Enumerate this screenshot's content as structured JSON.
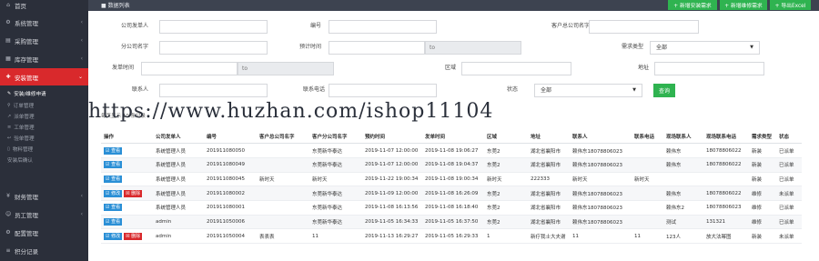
{
  "sidebar": {
    "items": [
      {
        "label": "首页",
        "icon": "home-icon",
        "top": 0
      },
      {
        "label": "系统管理",
        "icon": "gear-icon"
      },
      {
        "label": "采购管理",
        "icon": "cart-icon"
      },
      {
        "label": "库存管理",
        "icon": "box-icon"
      },
      {
        "label": "安装管理",
        "icon": "wrench-icon"
      }
    ],
    "submenu": [
      "安装/维修申请",
      "订单管理",
      "派单管理",
      "工单管理",
      "验单管理",
      "物料管理",
      "安装后确认"
    ],
    "items_after": [
      {
        "label": "财务管理",
        "icon": "money-icon"
      },
      {
        "label": "员工管理",
        "icon": "user-icon"
      },
      {
        "label": "配置管理",
        "icon": "settings-icon"
      },
      {
        "label": "积分记录",
        "icon": "list-icon"
      }
    ]
  },
  "header": {
    "title": "数据列表",
    "buttons": [
      "+ 新增安装需求",
      "+ 新增维修需求",
      "+ 导出Excel"
    ]
  },
  "filters": {
    "requester_label": "公司发单人",
    "number_label": "编号",
    "client_company_label": "客户总公司名字",
    "branch_label": "分公司名字",
    "appointment_label": "预计时间",
    "range_to": "to",
    "demand_type_label": "需求类型",
    "demand_type_value": "全部",
    "order_time_label": "发单时间",
    "area_label": "区域",
    "address_label": "地址",
    "contact_label": "联系人",
    "phone_label": "联系电话",
    "status_label": "状态",
    "status_value": "全部",
    "search_button": "查询"
  },
  "summary": "每页显示 10 条记录",
  "watermark": "https://www.huzhan.com/ishop11104",
  "table": {
    "headers": [
      "操作",
      "公司发单人",
      "编号",
      "客户总公司名字",
      "客户分公司名字",
      "预约时间",
      "发单时间",
      "区域",
      "地址",
      "联系人",
      "联系电话",
      "现场联系人",
      "现场联系电话",
      "需求类型",
      "状态"
    ],
    "rows": [
      {
        "actions": [
          "查看"
        ],
        "cells": [
          "系统管理人员",
          "201911080050",
          "",
          "东莞新华泰达",
          "2019-11-07 12:00:00",
          "2019-11-08 19:06:27",
          "东莞2",
          "湖北省襄阳市",
          "赖伟东18078806023",
          "",
          "赖伟东",
          "18078806022",
          "新装",
          "已派单"
        ]
      },
      {
        "actions": [
          "查看"
        ],
        "cells": [
          "系统管理人员",
          "201911080049",
          "",
          "东莞新华泰达",
          "2019-11-07 12:00:00",
          "2019-11-08 19:04:37",
          "东莞2",
          "湖北省襄阳市",
          "赖伟东18078806023",
          "",
          "赖伟东",
          "18078806022",
          "新装",
          "已派单"
        ]
      },
      {
        "actions": [
          "查看"
        ],
        "cells": [
          "系统管理人员",
          "201911080045",
          "新时天",
          "新时天",
          "2019-11-22 19:00:34",
          "2019-11-08 19:00:34",
          "新时天",
          "222333",
          "新时天",
          "新时天",
          "",
          "",
          "新装",
          "已派单"
        ]
      },
      {
        "actions": [
          "修改",
          "删除"
        ],
        "cells": [
          "系统管理人员",
          "201911080002",
          "",
          "东莞新华泰达",
          "2019-11-09 12:00:00",
          "2019-11-08 16:26:09",
          "东莞2",
          "湖北省襄阳市",
          "赖伟东18078806023",
          "",
          "赖伟东",
          "18078806022",
          "维修",
          "未派单"
        ]
      },
      {
        "actions": [
          "查看"
        ],
        "cells": [
          "系统管理人员",
          "201911080001",
          "",
          "东莞新华泰达",
          "2019-11-08 16:13:56",
          "2019-11-08 16:18:40",
          "东莞2",
          "湖北省襄阳市",
          "赖伟东18078806023",
          "",
          "赖伟东2",
          "18078806023",
          "维修",
          "已派单"
        ]
      },
      {
        "actions": [
          "查看"
        ],
        "cells": [
          "admin",
          "201911050006",
          "",
          "东莞新华泰达",
          "2019-11-05 16:34:33",
          "2019-11-05 16:37:50",
          "东莞2",
          "湖北省襄阳市",
          "赖伟东18078806023",
          "",
          "测试",
          "131321",
          "维修",
          "已派单"
        ]
      },
      {
        "actions": [
          "修改",
          "删除"
        ],
        "cells": [
          "admin",
          "201911050004",
          "表表表",
          "11",
          "2019-11-13 16:29:27",
          "2019-11-05 16:29:33",
          "1",
          "新疗我士大夫谢",
          "11",
          "11",
          "123人",
          "放大法幂图",
          "新装",
          "未派单"
        ]
      }
    ]
  }
}
